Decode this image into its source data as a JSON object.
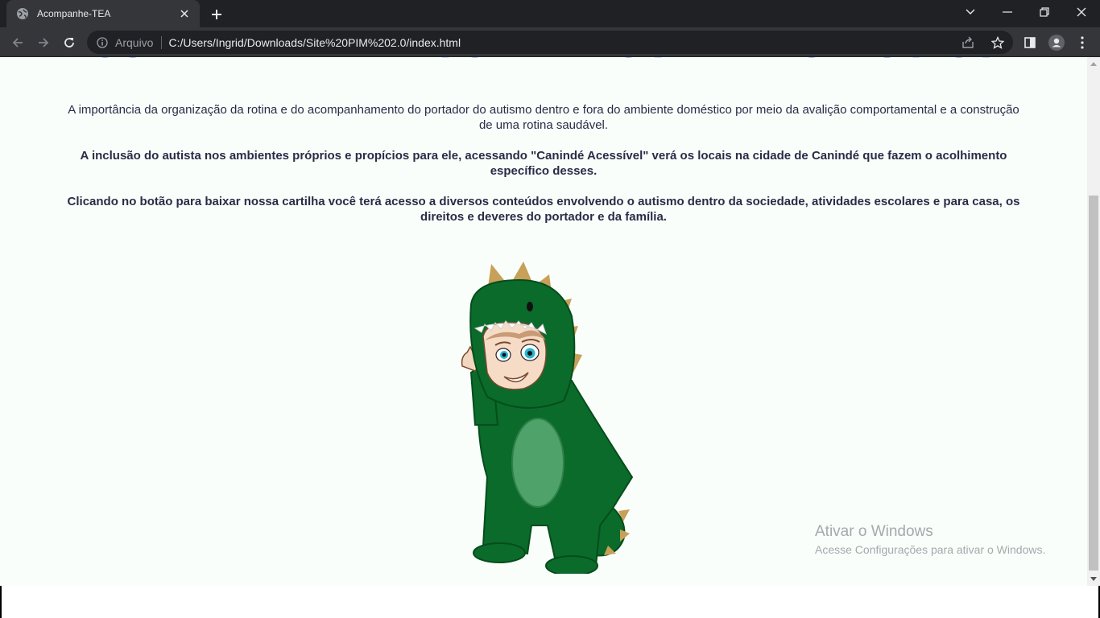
{
  "browser": {
    "tab_title": "Acompanhe-TEA",
    "scheme_label": "Arquivo",
    "url": "C:/Users/Ingrid/Downloads/Site%20PIM%202.0/index.html"
  },
  "page": {
    "heading": "ACOMPANHAMENTO NA ROTINA DO AUTISTA",
    "paragraph_1": "A importância da organização da rotina e do acompanhamento do portador do autismo dentro e fora do ambiente doméstico por meio da avalição comportamental e a construção de uma rotina saudável.",
    "paragraph_2": "A inclusão do autista nos ambientes próprios e propícios para ele, acessando \"Canindé Acessível\" verá os locais na cidade de Canindé que fazem o acolhimento específico desses.",
    "paragraph_3": "Clicando no botão para baixar nossa cartilha você terá acesso a diversos conteúdos envolvendo o autismo dentro da sociedade, atividades escolares e para casa, os direitos e deveres do portador e da família."
  },
  "watermark": {
    "line1": "Ativar o Windows",
    "line2": "Acesse Configurações para ativar o Windows."
  },
  "colors": {
    "heading": "#4f78e5",
    "text": "#2c2b46",
    "page_bg": "#f9fefb",
    "chrome_dark": "#202124",
    "chrome_toolbar": "#35363a"
  }
}
